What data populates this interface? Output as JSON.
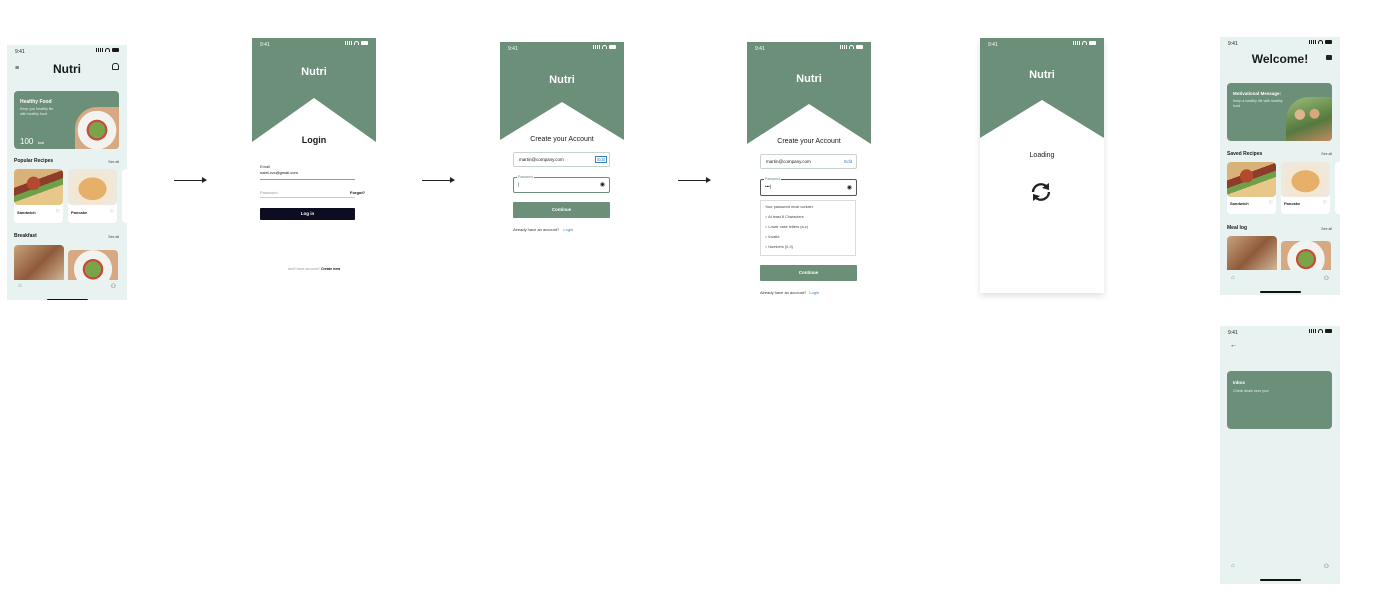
{
  "status": {
    "time": "9:41"
  },
  "screen_home": {
    "title": "Nutri",
    "hero_title": "Healthy Food",
    "hero_body": "Keep you healthy life with healthy food",
    "hero_count": "100",
    "hero_unit": "kcal",
    "section_popular": "Popular Recipes",
    "see_all": "See all",
    "recipe_1": "Sandwich",
    "recipe_2": "Pancake",
    "section_breakfast": "Breakfast"
  },
  "screen_login": {
    "brand": "Nutri",
    "title": "Login",
    "email_label": "Email",
    "email_value": "nabil.cvc@gmail.com",
    "password_label": "Password",
    "forgot": "Forgot?",
    "login_button": "Log in",
    "no_account": "don't have account?",
    "create_new": "Create new"
  },
  "screen_create": {
    "brand": "Nutri",
    "title": "Create your Account",
    "email_value": "martin@company.com",
    "edit": "Edit",
    "password_label": "Password",
    "continue_button": "Continue",
    "already": "Already have an account?",
    "login_link": "Login"
  },
  "screen_create2": {
    "brand": "Nutri",
    "title": "Create your Account",
    "email_value": "martin@company.com",
    "edit": "Edit",
    "password_label": "Password",
    "password_dots": "•••|",
    "rules_title": "Your password must contain:",
    "rule_1": "At least 8 Characters",
    "rule_2": "Lower case letters (a-z)",
    "rule_3": "Invalid",
    "rule_4": "Numbers (0-9)",
    "continue_button": "Continue",
    "already": "Already have an account?",
    "login_link": "Login"
  },
  "screen_loading": {
    "brand": "Nutri",
    "label": "Loading"
  },
  "screen_welcome": {
    "title": "Welcome!",
    "motiv_title": "Motivational Message:",
    "motiv_body": "Keep a healthy life with healthy food",
    "section_saved": "Saved Recipes",
    "see_all": "See all",
    "recipe_1": "Sandwich",
    "recipe_2": "Pancake",
    "section_meal": "Meal log"
  },
  "screen_inbox": {
    "card_title": "Inbox",
    "card_body": "Check deals near you!"
  },
  "colors": {
    "brand_green": "#6b8f79",
    "button_dark": "#0d0d22",
    "link_blue": "#3b82c4",
    "mint_bg": "#e8f2f1"
  }
}
